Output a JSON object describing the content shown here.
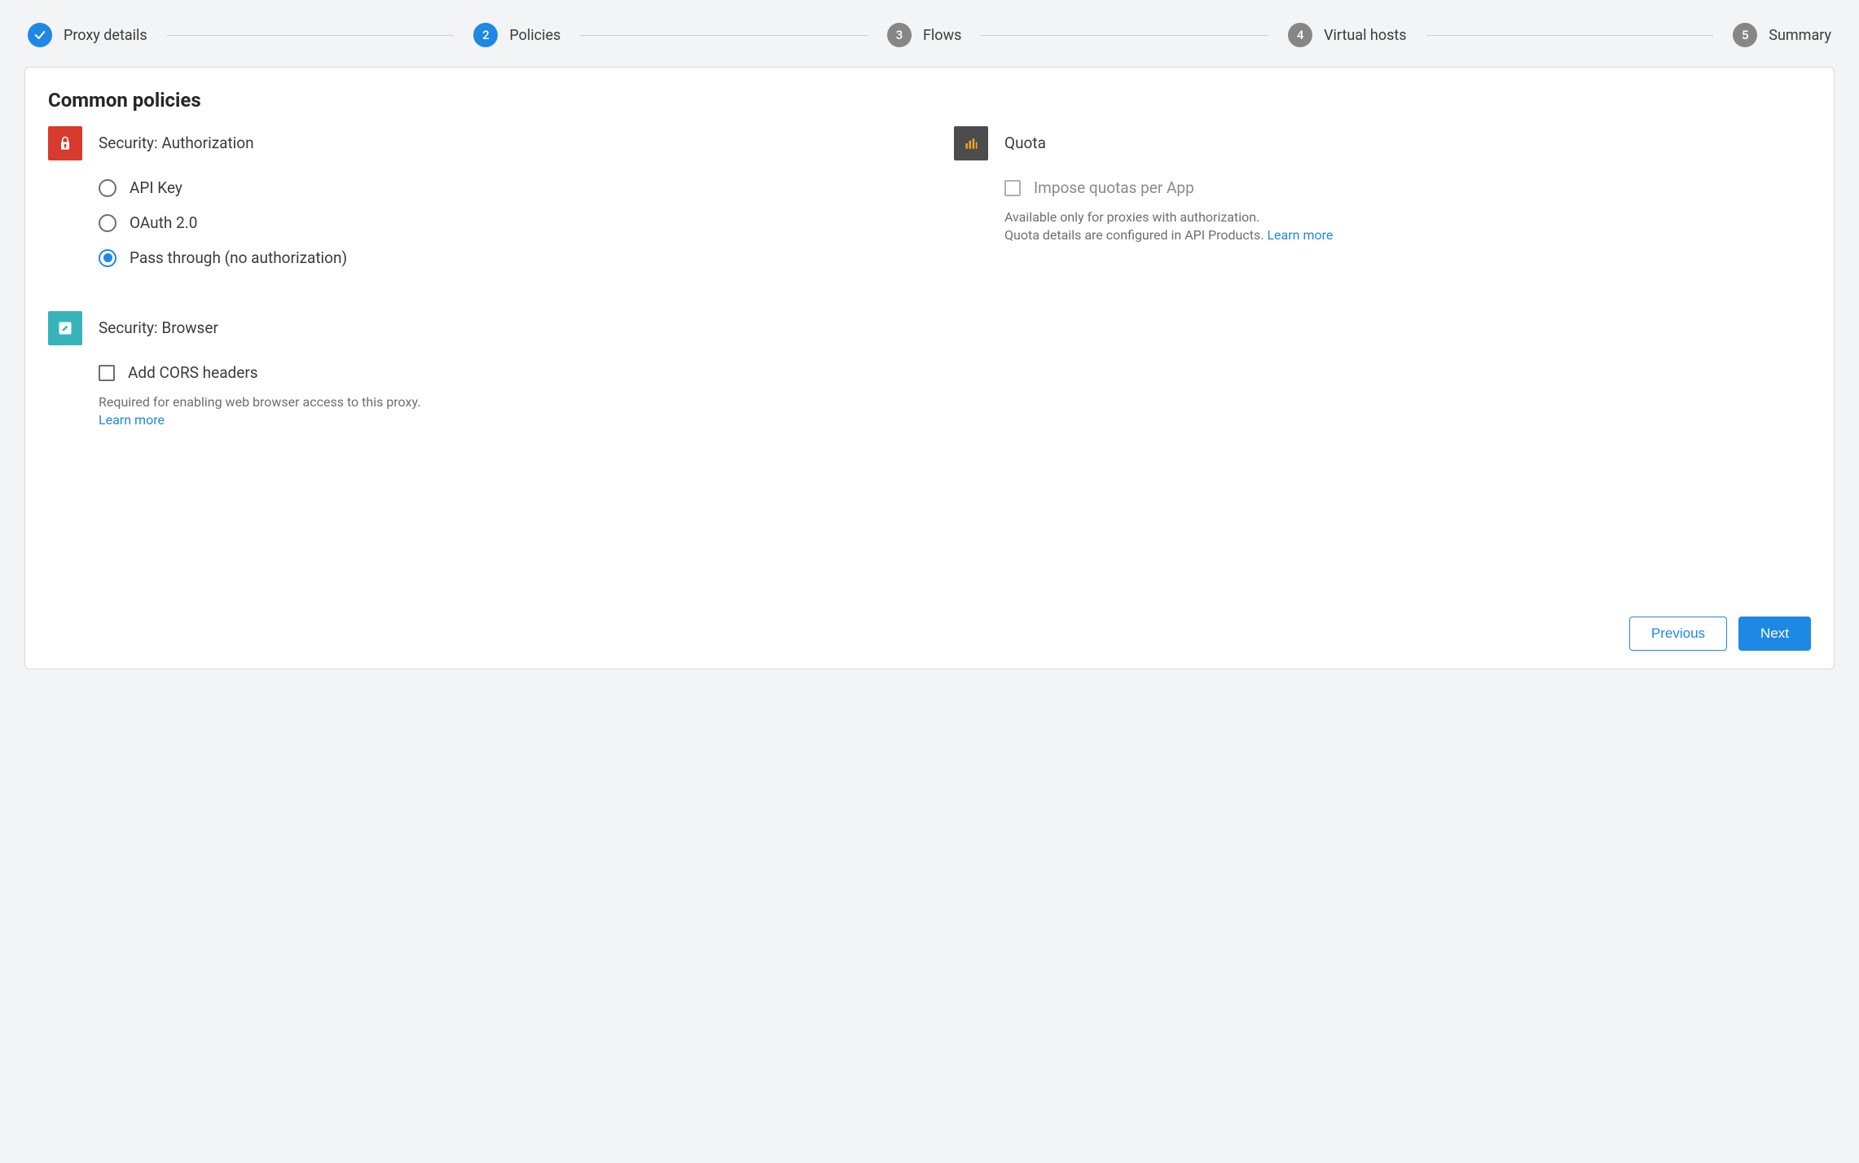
{
  "stepper": {
    "steps": [
      {
        "label": "Proxy details",
        "state": "done"
      },
      {
        "label": "Policies",
        "number": "2",
        "state": "active"
      },
      {
        "label": "Flows",
        "number": "3",
        "state": "upcoming"
      },
      {
        "label": "Virtual hosts",
        "number": "4",
        "state": "upcoming"
      },
      {
        "label": "Summary",
        "number": "5",
        "state": "upcoming"
      }
    ]
  },
  "page": {
    "heading": "Common policies"
  },
  "security_authorization": {
    "title": "Security: Authorization",
    "options": {
      "api_key": "API Key",
      "oauth": "OAuth 2.0",
      "pass_through": "Pass through (no authorization)"
    },
    "selected": "pass_through"
  },
  "security_browser": {
    "title": "Security: Browser",
    "checkbox_label": "Add CORS headers",
    "help": "Required for enabling web browser access to this proxy.",
    "learn_more": "Learn more"
  },
  "quota": {
    "title": "Quota",
    "checkbox_label": "Impose quotas per App",
    "help_line1": "Available only for proxies with authorization.",
    "help_line2": "Quota details are configured in API Products. ",
    "learn_more": "Learn more"
  },
  "footer": {
    "previous": "Previous",
    "next": "Next"
  }
}
